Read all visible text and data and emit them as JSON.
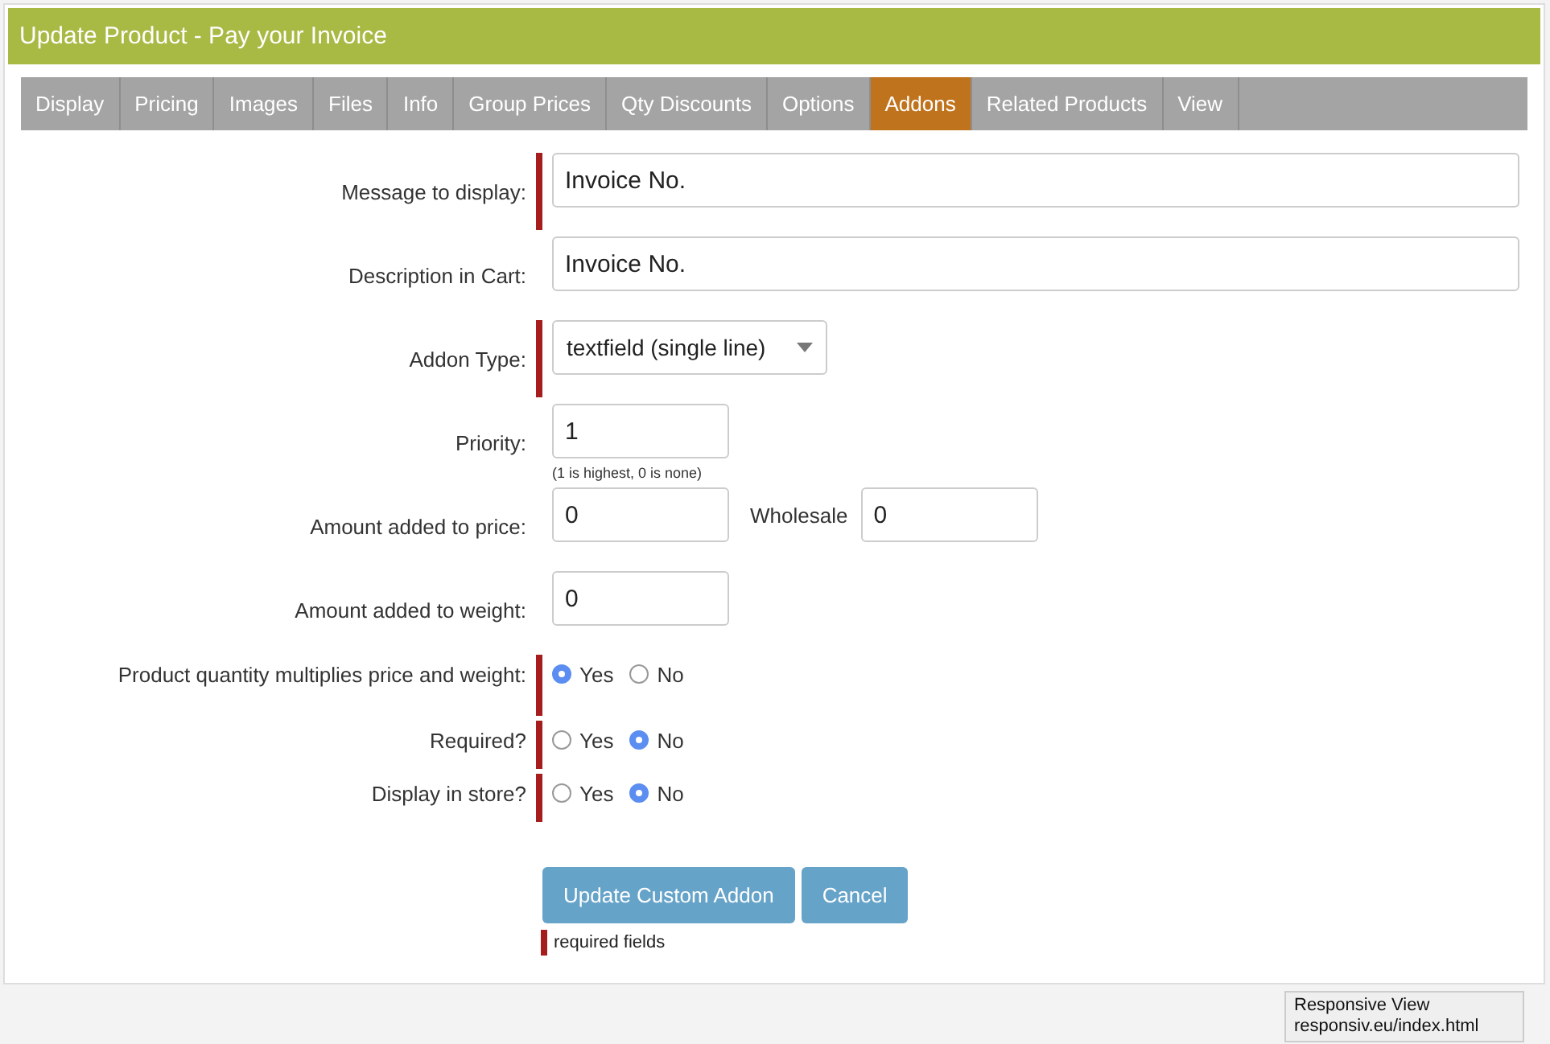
{
  "window": {
    "title": "Update Product - Pay your Invoice"
  },
  "tabs": [
    {
      "label": "Display",
      "selected": false
    },
    {
      "label": "Pricing",
      "selected": false
    },
    {
      "label": "Images",
      "selected": false
    },
    {
      "label": "Files",
      "selected": false
    },
    {
      "label": "Info",
      "selected": false
    },
    {
      "label": "Group Prices",
      "selected": false
    },
    {
      "label": "Qty Discounts",
      "selected": false
    },
    {
      "label": "Options",
      "selected": false
    },
    {
      "label": "Addons",
      "selected": true
    },
    {
      "label": "Related Products",
      "selected": false
    },
    {
      "label": "View",
      "selected": false
    }
  ],
  "fields": [
    {
      "kind": "text",
      "label": "Message to display:",
      "required": true,
      "value": "Invoice No."
    },
    {
      "kind": "text",
      "label": "Description in Cart:",
      "required": false,
      "value": "Invoice No."
    },
    {
      "kind": "select",
      "label": "Addon Type:",
      "required": true,
      "value": "textfield (single line)"
    },
    {
      "kind": "number",
      "label": "Priority:",
      "required": false,
      "value": "1",
      "hint": "(1 is highest, 0 is none)"
    },
    {
      "kind": "number",
      "label": "Amount added to price:",
      "required": false,
      "value": "0",
      "extra_label": "Wholesale",
      "extra_value": "0"
    },
    {
      "kind": "number",
      "label": "Amount added to weight:",
      "required": false,
      "value": "0"
    },
    {
      "kind": "radio",
      "label": "Product quantity multiplies price and weight:",
      "required": true,
      "options": [
        {
          "label": "Yes",
          "selected": true
        },
        {
          "label": "No",
          "selected": false
        }
      ]
    },
    {
      "kind": "radio",
      "label": "Required?",
      "required": true,
      "options": [
        {
          "label": "Yes",
          "selected": false
        },
        {
          "label": "No",
          "selected": true
        }
      ]
    },
    {
      "kind": "radio",
      "label": "Display in store?",
      "required": true,
      "options": [
        {
          "label": "Yes",
          "selected": false
        },
        {
          "label": "No",
          "selected": true
        }
      ]
    }
  ],
  "buttons": [
    "Update Custom Addon",
    "Cancel"
  ],
  "legend": "required fields",
  "tooltip": {
    "title": "Responsive View",
    "url": "responsiv.eu/index.html"
  }
}
